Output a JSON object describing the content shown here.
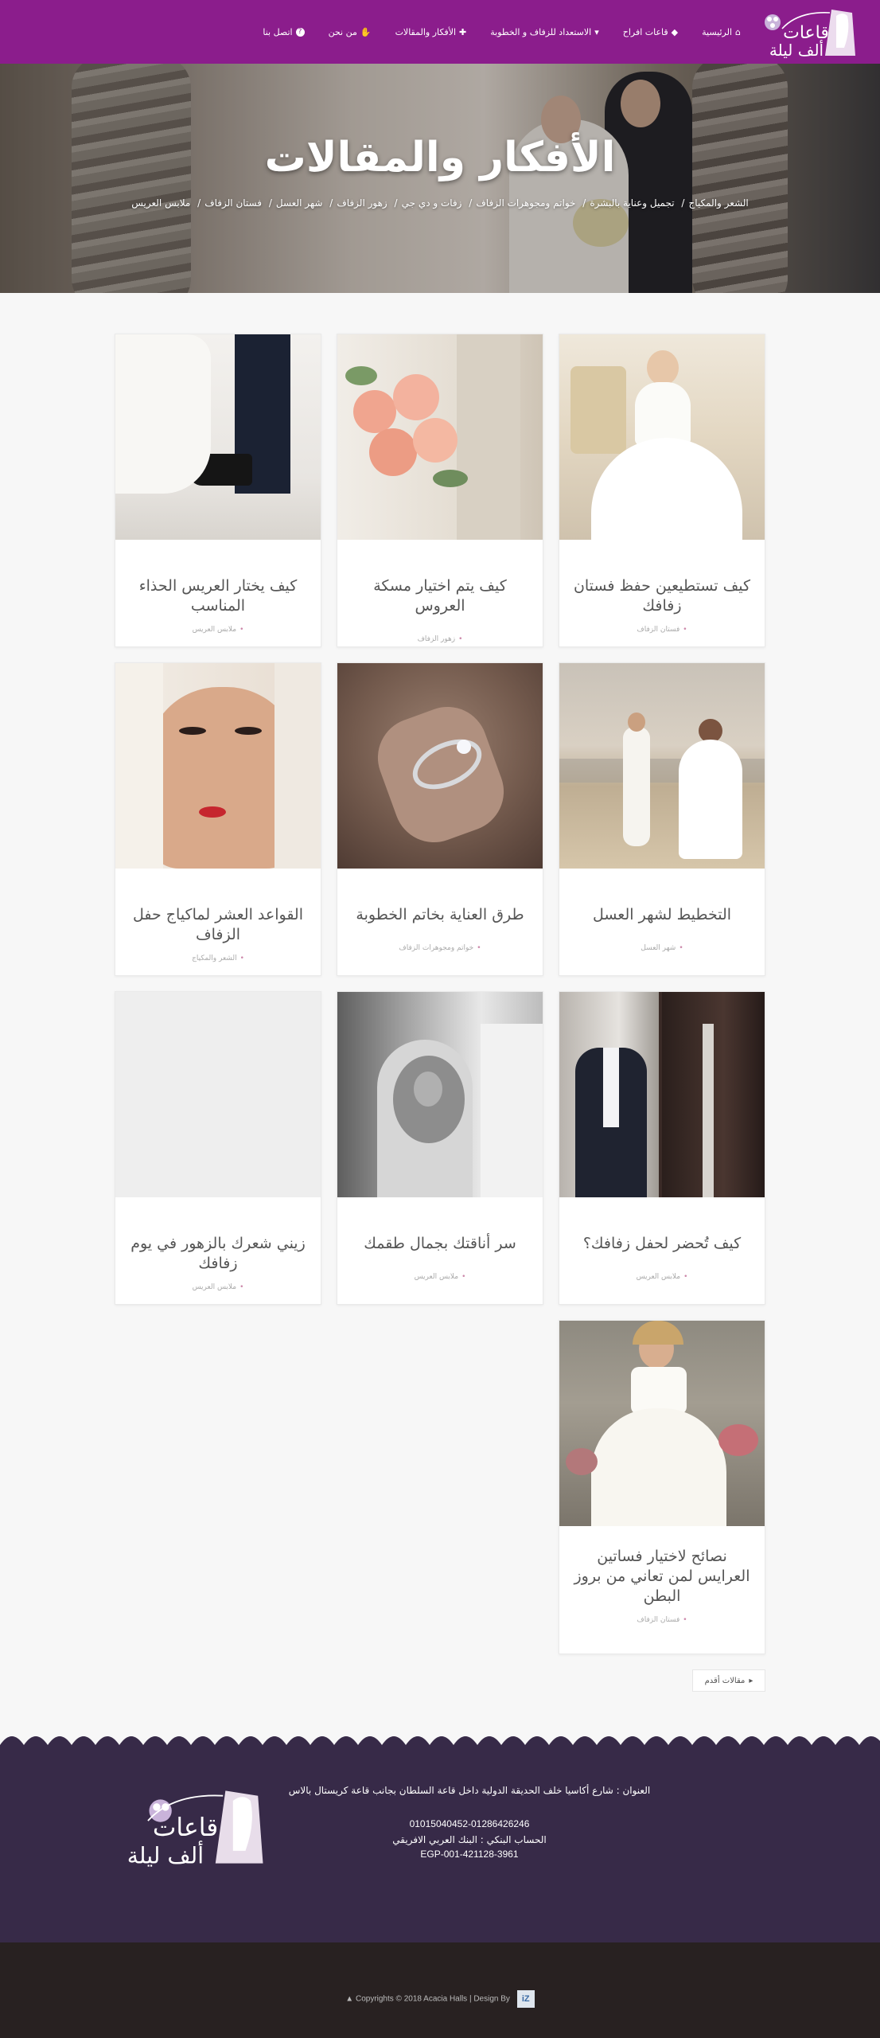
{
  "brand": {
    "logo_text": "قاعات ألف ليلة",
    "accent": "#8b1d8c"
  },
  "nav": [
    {
      "label": "الرئيسية",
      "icon": "home-icon",
      "glyph": "⌂"
    },
    {
      "label": "قاعات افراح",
      "icon": "diamond-icon",
      "glyph": "◆"
    },
    {
      "label": "الاستعداد للزفاف و الخطوبة",
      "icon": "glass-icon",
      "glyph": "🍷"
    },
    {
      "label": "الأفكار والمقالات",
      "icon": "puzzle-icon",
      "glyph": "✚"
    },
    {
      "label": "من نحن",
      "icon": "handshake-icon",
      "glyph": "✋"
    },
    {
      "label": "اتصل بنا",
      "icon": "question-icon",
      "glyph": "?"
    }
  ],
  "hero": {
    "title": "الأفكار والمقالات",
    "breadcrumb": [
      "الشعر والمكياج",
      "تجميل وعناية بالبشرة",
      "خواتم ومجوهرات الزفاف",
      "زفات و دي جي",
      "زهور الزفاف",
      "شهر العسل",
      "فستان الزفاف",
      "ملابس العريس"
    ]
  },
  "articles": [
    {
      "title": "كيف تستطيعين حفظ فستان زفافك",
      "category": "فستان الزفاف"
    },
    {
      "title": "كيف يتم اختيار مسكة العروس",
      "category": "زهور الزفاف"
    },
    {
      "title": "كيف يختار العريس الحذاء المناسب",
      "category": "ملابس العريس"
    },
    {
      "title": "التخطيط لشهر العسل",
      "category": "شهر العسل"
    },
    {
      "title": "طرق العناية بخاتم الخطوبة",
      "category": "خواتم ومجوهرات الزفاف"
    },
    {
      "title": "القواعد العشر لماكياج حفل الزفاف",
      "category": "الشعر والمكياج"
    },
    {
      "title": "كيف تُحضر لحفل زفافك؟",
      "category": "ملابس العريس"
    },
    {
      "title": "سر أناقتك بجمال طقمك",
      "category": "ملابس العريس"
    },
    {
      "title": "زيني شعرك بالزهور في يوم زفافك",
      "category": "ملابس العريس"
    },
    {
      "title": "نصائح لاختيار فساتين العرايس لمن تعاني من بروز البطن",
      "category": "فستان الزفاف"
    }
  ],
  "pagination": {
    "older_label": "مقالات أقدم"
  },
  "footer": {
    "address": "العنوان : شارع أكاسيا خلف الحديقة الدولية داخل قاعة السلطان بجانب قاعة كريستال بالاس",
    "phones": "01015040452-01286426246",
    "bank": "الحساب البنكي : البنك العربي الافريقي",
    "account": "EGP-001-421128-3961",
    "copyright": "Copyrights © 2018 Acacia Halls | Design By"
  }
}
